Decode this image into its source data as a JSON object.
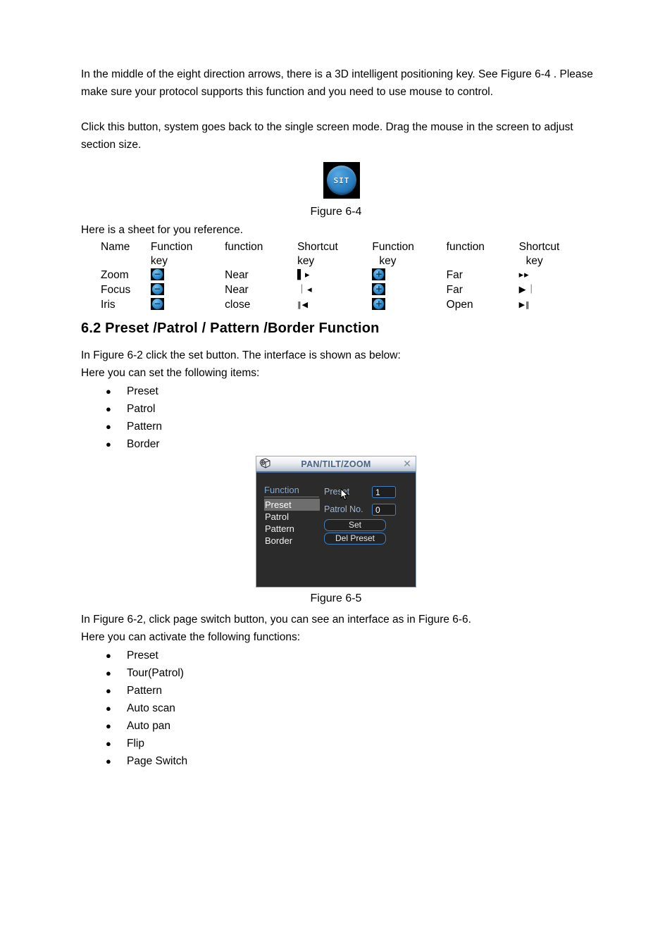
{
  "document": {
    "paragraph_1": "In the middle of the eight direction arrows, there is a 3D intelligent positioning key. See Figure 6-4 . Please make sure your protocol supports this function and you need to use mouse to control.",
    "paragraph_2": "Click this button, system goes back to the single screen mode. Drag the mouse in the screen to adjust section size.",
    "figure_6_4_caption": "Figure 6-4",
    "figure_6_5_caption": "Figure 6-5",
    "sheet_intro": "Here is a sheet for you reference.",
    "section_heading": "6.2  Preset  /Patrol / Pattern /Border  Function",
    "after_heading_line_1": "In Figure 6-2 click the set button. The interface is shown as below:",
    "after_heading_line_2": "Here you can set the following items:",
    "after_figure_line_1": "In Figure 6-2, click page switch button, you can see an interface as in Figure 6-6.",
    "after_figure_line_2": "Here you can activate the following functions:"
  },
  "figure_6_4": {
    "button_label": "SIT",
    "button_color": "#2f86c8",
    "background_color": "#000000"
  },
  "reference_table": {
    "headers": [
      "Name",
      "Function key",
      "function",
      "Shortcut key",
      "Function key",
      "function",
      "Shortcut key"
    ],
    "header_line1": [
      "Name",
      "Function",
      "function",
      "Shortcut",
      "Function",
      "function",
      "Shortcut"
    ],
    "header_line2": [
      "",
      "key",
      "",
      "key",
      "key",
      "",
      "key"
    ],
    "rows": [
      {
        "name": "Zoom",
        "function_key_1": "minus-button",
        "function_1": "Near",
        "shortcut_key_1": "▌▸",
        "function_key_2": "plus-button",
        "function_2": "Far",
        "shortcut_key_2": "▸▸"
      },
      {
        "name": "Focus",
        "function_key_1": "minus-button",
        "function_1": "Near",
        "shortcut_key_1": "｜◂",
        "function_key_2": "plus-button",
        "function_2": "Far",
        "shortcut_key_2": "▶｜"
      },
      {
        "name": "Iris",
        "function_key_1": "minus-button",
        "function_1": "close",
        "shortcut_key_1": "‖◀",
        "function_key_2": "plus-button",
        "function_2": "Open",
        "shortcut_key_2": "▶‖"
      }
    ],
    "minus_sign": "−",
    "plus_sign": "+"
  },
  "list_set_items": [
    "Preset",
    "Patrol",
    "Pattern",
    "Border"
  ],
  "list_activate_items": [
    "Preset",
    "Tour(Patrol)",
    "Pattern",
    "Auto scan",
    "Auto pan",
    "Flip",
    "Page Switch"
  ],
  "bullet_glyph": "●",
  "ptz_dialog": {
    "title": "PAN/TILT/ZOOM",
    "close_label": "✕",
    "menu_header": "Function",
    "menu_items": [
      "Preset",
      "Patrol",
      "Pattern",
      "Border"
    ],
    "selected_menu_item": "Preset",
    "fields": [
      {
        "label": "Preset",
        "value": "1"
      },
      {
        "label": "Patrol No.",
        "value": "0"
      }
    ],
    "buttons": [
      "Set",
      "Del Preset"
    ],
    "colors": {
      "body_background": "#2b2b2b",
      "accent_border": "#3f7fc4",
      "title_text": "#4a6384",
      "menu_header_text": "#7ba7d8",
      "selection_background": "#6e6e6e"
    }
  }
}
